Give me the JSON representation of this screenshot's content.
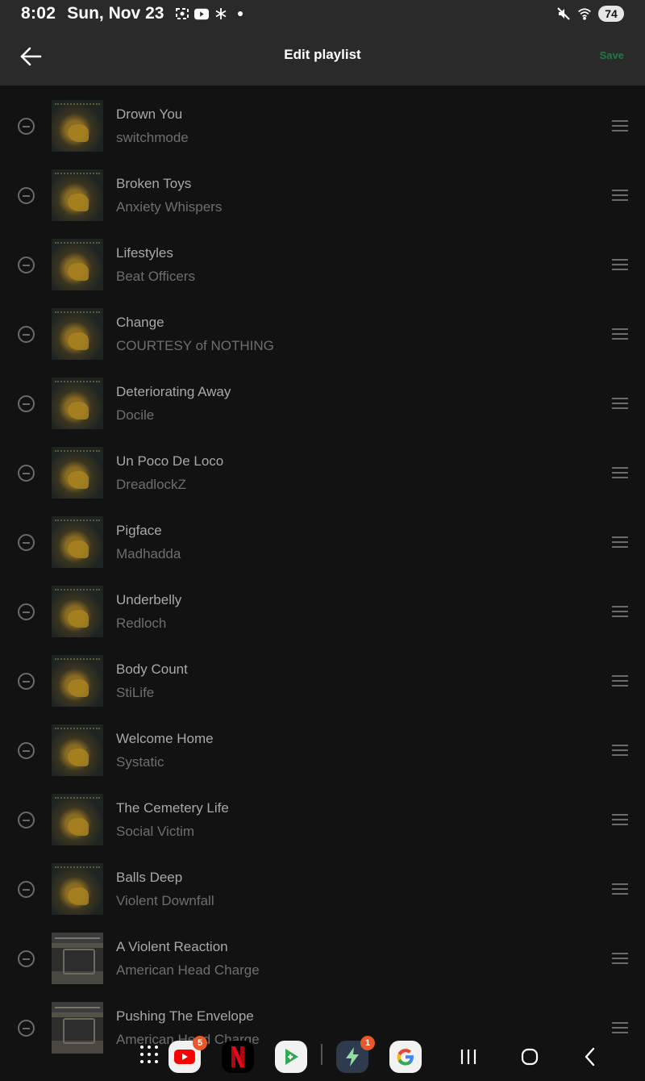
{
  "status_bar": {
    "time": "8:02",
    "date": "Sun, Nov 23",
    "battery": "74",
    "left_icons": [
      "screenshot-icon",
      "youtube-icon",
      "snowflake-icon",
      "dot-icon"
    ],
    "right_icons": [
      "mute-icon",
      "wifi-icon",
      "battery-icon"
    ]
  },
  "header": {
    "title": "Edit playlist",
    "save_label": "Save",
    "back_icon": "arrow-left-icon",
    "accent_color": "#1db954"
  },
  "tracks": [
    {
      "title": "Drown You",
      "artist": "switchmode",
      "cover": "a"
    },
    {
      "title": "Broken Toys",
      "artist": "Anxiety Whispers",
      "cover": "a"
    },
    {
      "title": "Lifestyles",
      "artist": "Beat Officers",
      "cover": "a"
    },
    {
      "title": "Change",
      "artist": "COURTESY of NOTHING",
      "cover": "a"
    },
    {
      "title": "Deteriorating Away",
      "artist": "Docile",
      "cover": "a"
    },
    {
      "title": "Un Poco De Loco",
      "artist": "DreadlockZ",
      "cover": "a"
    },
    {
      "title": "Pigface",
      "artist": "Madhadda",
      "cover": "a"
    },
    {
      "title": "Underbelly",
      "artist": "Redloch",
      "cover": "a"
    },
    {
      "title": "Body Count",
      "artist": "StiLife",
      "cover": "a"
    },
    {
      "title": "Welcome Home",
      "artist": "Systatic",
      "cover": "a"
    },
    {
      "title": "The Cemetery Life",
      "artist": "Social Victim",
      "cover": "a"
    },
    {
      "title": "Balls Deep",
      "artist": "Violent Downfall",
      "cover": "a"
    },
    {
      "title": "A Violent Reaction",
      "artist": "American Head Charge",
      "cover": "b"
    },
    {
      "title": "Pushing The Envelope",
      "artist": "American Head Charge",
      "cover": "b"
    }
  ],
  "taskbar": {
    "apps": [
      {
        "name": "youtube",
        "badge": "5",
        "color": "#ff0000"
      },
      {
        "name": "netflix",
        "badge": "",
        "color": "#e50914"
      },
      {
        "name": "google-play-games",
        "badge": "",
        "color": "#34a853"
      },
      {
        "name": "power-app",
        "badge": "1",
        "color": "#2e3b4e"
      },
      {
        "name": "google",
        "badge": "",
        "color": "#4285f4"
      }
    ],
    "nav": [
      "recents-icon",
      "home-icon",
      "back-icon"
    ]
  }
}
